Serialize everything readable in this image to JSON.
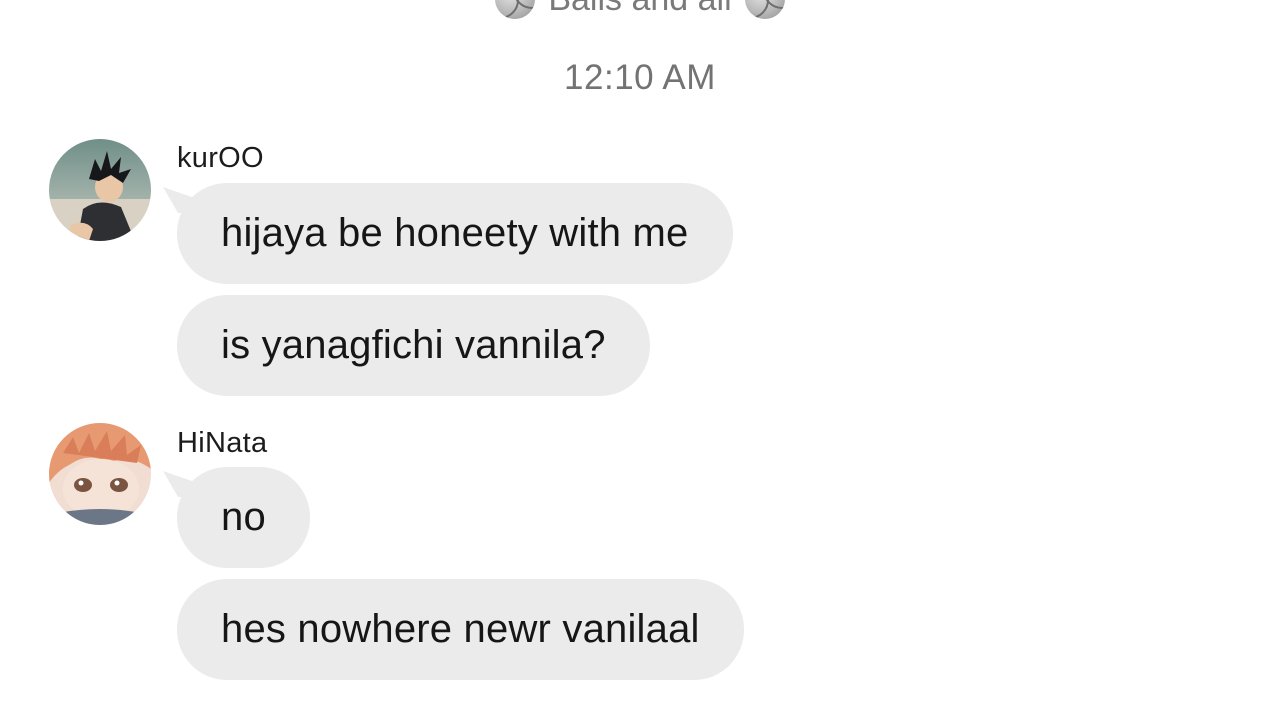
{
  "conversation": {
    "group_name": "Balls and all",
    "timestamp": "12:10 AM"
  },
  "messages": [
    {
      "sender": "kurOO",
      "avatar_icon": "kuroo-avatar-icon",
      "texts": [
        "hijaya be honeety with me",
        "is yanagfichi vannila?"
      ]
    },
    {
      "sender": "HiNata",
      "avatar_icon": "hinata-avatar-icon",
      "texts": [
        "no",
        "hes nowhere newr vanilaal"
      ]
    }
  ],
  "colors": {
    "bubble_bg": "#ebebeb",
    "text": "#161616",
    "timestamp": "#737373"
  }
}
